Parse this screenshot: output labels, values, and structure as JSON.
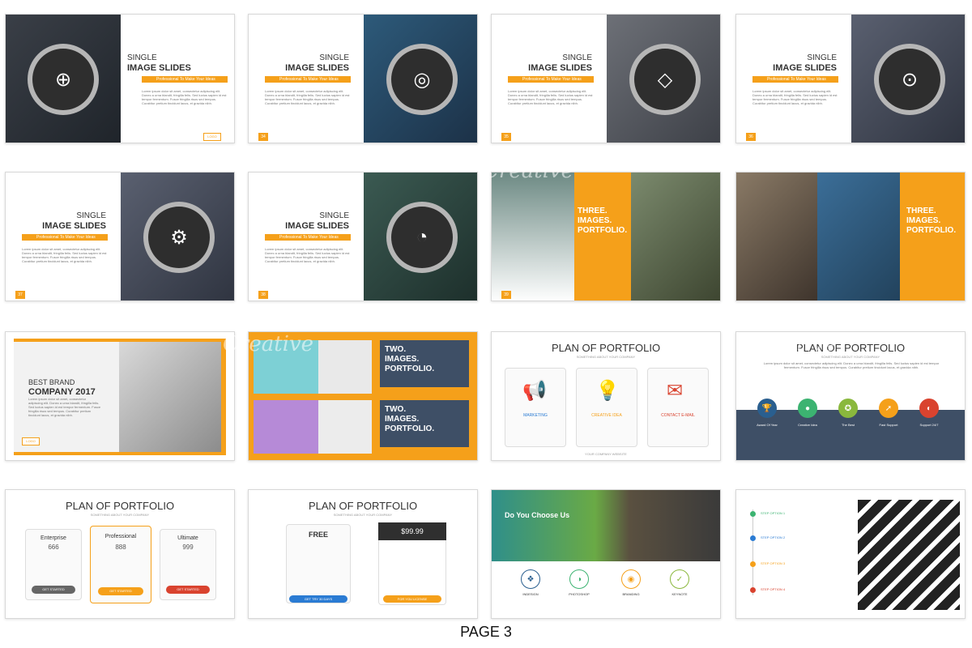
{
  "footer": {
    "label": "PAGE 3"
  },
  "single": {
    "title_a": "SINGLE",
    "title_b": "IMAGE SLIDES",
    "tagline": "Professional To Make Your Ideas",
    "lorem": "Lorem ipsum dolor sit amet, consectetur adipiscing elit. Donec a urna blandit, fringilla felis. Sed luctus sapien id est tempor fermentum. Fusce fringilla risus sed tempus. Curabitur pretium tincidunt lacus, et gravida nibh.",
    "nums": [
      "34",
      "34",
      "35",
      "36",
      "37",
      "38"
    ],
    "logo": "LOGO"
  },
  "three": {
    "title_a": "THREE.",
    "title_b": "IMAGES.",
    "title_c": "PORTFOLIO.",
    "num": "39"
  },
  "brand": {
    "title_a": "BEST BRAND",
    "title_b": "COMPANY 2017",
    "side": "ZAGE.BEST SOLUTIONS FOR YOU"
  },
  "two": {
    "title_a": "TWO.",
    "title_b": "IMAGES.",
    "title_c": "PORTFOLIO."
  },
  "plan": {
    "title": "PLAN OF PORTFOLIO",
    "sub": "SOMETHING ABOUT YOUR COMPANY",
    "website": "YOUR COMPANY WEBSITE",
    "cards": [
      "MARKETING",
      "CREATIVE IDEA",
      "CONTACT E-MAIL"
    ],
    "award_labels": [
      "Award Of Year",
      "Creative Idea",
      "The Best",
      "Fast Support",
      "Support 24/7"
    ],
    "pricing": [
      {
        "name": "Enterprise",
        "price": "666",
        "period": "/month",
        "btn": "GET STARTED"
      },
      {
        "name": "Professional",
        "price": "888",
        "period": "/month",
        "btn": "GET STARTED"
      },
      {
        "name": "Ultimate",
        "price": "999",
        "period": "/month",
        "btn": "GET STARTED"
      }
    ],
    "free": {
      "name": "FREE",
      "plan": "PROFESSIONAL",
      "table": "Pricing Table",
      "btn": "GET TRY 30 DAYS"
    },
    "premium": {
      "price": "$99.99",
      "plan": "ULTIMATE",
      "table": "Pricing Table",
      "btn": "FOR YOU LICENSE"
    },
    "options": [
      "OPTION 1",
      "OPTION 2",
      "OPTION 3"
    ]
  },
  "choose": {
    "title": "Do You Choose Us",
    "items": [
      "INDESIGN",
      "PHOTOSHOP",
      "BRANDING",
      "KEYNOTE"
    ]
  },
  "steps": [
    "STEP OPTION 1",
    "STEP OPTION 2",
    "STEP OPTION 3",
    "STEP OPTION 4"
  ],
  "watermark": "Creative",
  "colors": {
    "accent": "#f5a01a",
    "navy": "#3e4f66"
  }
}
